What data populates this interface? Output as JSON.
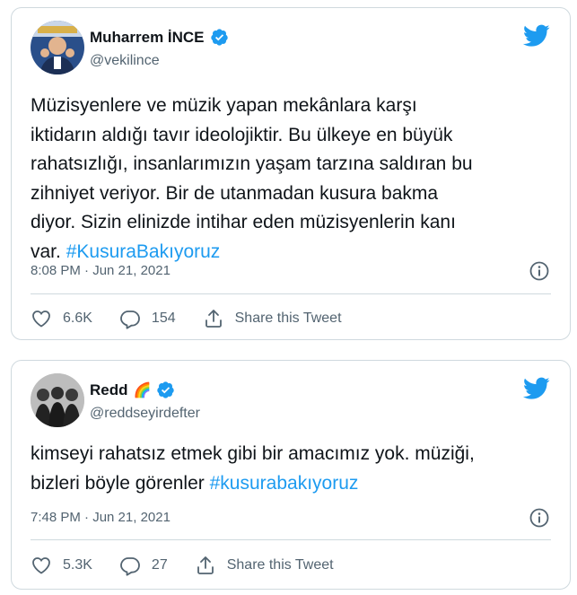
{
  "tweets": [
    {
      "display_name": "Muharrem İNCE",
      "handle": "@vekilince",
      "text": "Müzisyenlere ve müzik yapan mekânlara karşı\niktidarın aldığı tavır ideolojiktir. Bu ülkeye en büyük\nrahatsızlığı, insanlarımızın yaşam tarzına saldıran bu\nzihniyet veriyor. Bir de utanmadan kusura bakma\ndiyor. Sizin elinizde intihar eden müzisyenlerin kanı\nvar.",
      "hashtag": "#KusuraBakıyoruz",
      "timestamp": "8:08 PM · Jun 21, 2021",
      "likes": "6.6K",
      "replies": "154",
      "share_label": "Share this Tweet"
    },
    {
      "display_name": "Redd",
      "name_emoji": "🌈",
      "handle": "@reddseyirdefter",
      "text": "kimseyi rahatsız etmek gibi bir amacımız yok. müziği,\nbizleri böyle görenler",
      "hashtag": "#kusurabakıyoruz",
      "timestamp": "7:48 PM · Jun 21, 2021",
      "likes": "5.3K",
      "replies": "27",
      "share_label": "Share this Tweet"
    }
  ],
  "colors": {
    "accent": "#1d9bf0",
    "text": "#0f1419",
    "muted": "#536471",
    "border": "#cfd9de"
  },
  "icons": [
    "twitter-bird-icon",
    "verified-badge-icon",
    "info-icon",
    "heart-icon",
    "reply-icon",
    "share-icon"
  ]
}
